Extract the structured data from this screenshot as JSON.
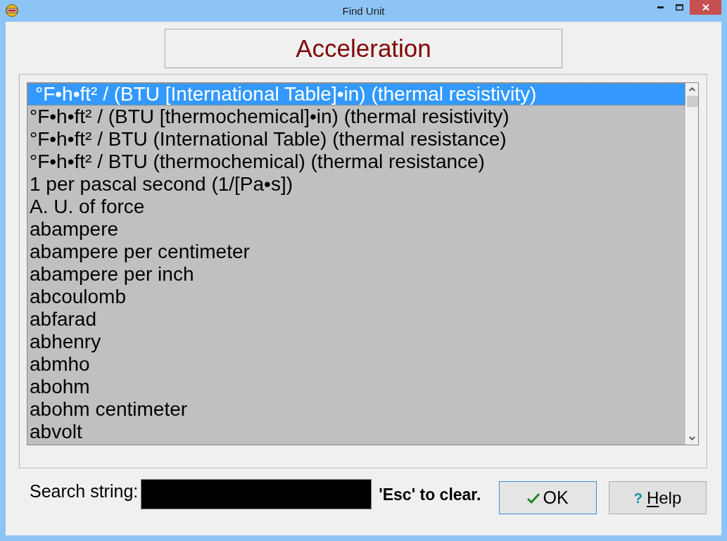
{
  "window": {
    "title": "Find Unit"
  },
  "heading": {
    "label": "Acceleration"
  },
  "unit_list": {
    "items": [
      {
        "label": "°F•h•ft² / (BTU [International Table]•in) (thermal resistivity)",
        "selected": true
      },
      {
        "label": "°F•h•ft² / (BTU [thermochemical]•in) (thermal resistivity)",
        "selected": false
      },
      {
        "label": "°F•h•ft² / BTU (International Table) (thermal resistance)",
        "selected": false
      },
      {
        "label": "°F•h•ft² / BTU (thermochemical) (thermal resistance)",
        "selected": false
      },
      {
        "label": "1 per pascal second (1/[Pa•s])",
        "selected": false
      },
      {
        "label": "A. U. of force",
        "selected": false
      },
      {
        "label": "abampere",
        "selected": false
      },
      {
        "label": "abampere per centimeter",
        "selected": false
      },
      {
        "label": "abampere per inch",
        "selected": false
      },
      {
        "label": "abcoulomb",
        "selected": false
      },
      {
        "label": "abfarad",
        "selected": false
      },
      {
        "label": "abhenry",
        "selected": false
      },
      {
        "label": "abmho",
        "selected": false
      },
      {
        "label": "abohm",
        "selected": false
      },
      {
        "label": "abohm centimeter",
        "selected": false
      },
      {
        "label": "abvolt",
        "selected": false
      }
    ]
  },
  "search": {
    "label": "Search string:",
    "note": "'Esc' to clear."
  },
  "buttons": [
    {
      "kind": "ok",
      "focused": true,
      "label_parts": [
        {
          "text": "OK",
          "underlined": false
        }
      ]
    },
    {
      "kind": "help",
      "focused": false,
      "glyph": "?",
      "label_parts": [
        {
          "text": "H",
          "underlined": true
        },
        {
          "text": "elp",
          "underlined": false
        }
      ]
    }
  ]
}
